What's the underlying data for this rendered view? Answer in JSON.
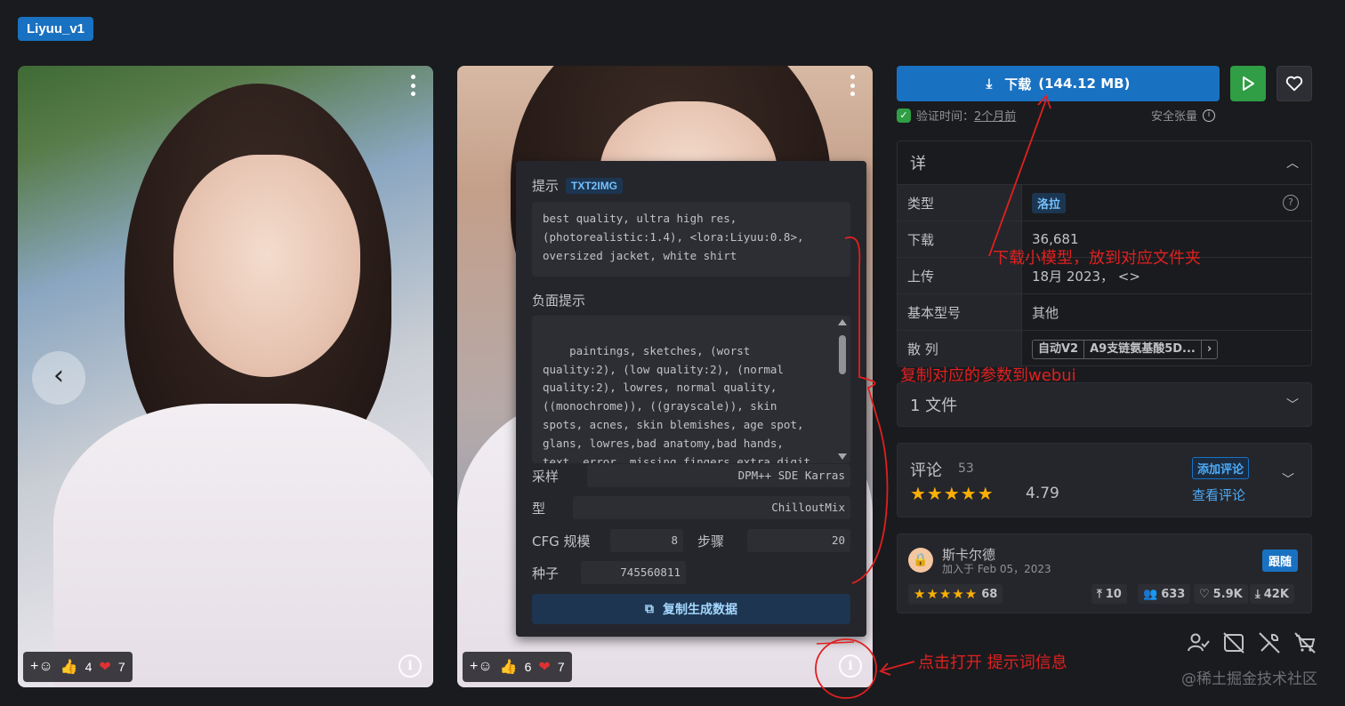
{
  "model_tag": "Liyuu_v1",
  "images": [
    {
      "reactions": {
        "add": "+",
        "like_count": "4",
        "heart_count": "7"
      }
    },
    {
      "reactions": {
        "add": "+",
        "like_count": "6",
        "heart_count": "7"
      }
    }
  ],
  "popup": {
    "prompt_label": "提示",
    "prompt_badge": "TXT2IMG",
    "prompt_text": "best quality, ultra high res, (photorealistic:1.4), <lora:Liyuu:0.8>, oversized jacket, white shirt",
    "negative_label": "负面提示",
    "negative_text": "paintings, sketches, (worst quality:2), (low quality:2), (normal quality:2), lowres, normal quality, ((monochrome)), ((grayscale)), skin spots, acnes, skin blemishes, age spot, glans, lowres,bad anatomy,bad hands, text, error, missing fingers,extra digit, fewer digits, cropped, worstquality, low quality, normal quality, jpegartifacts, signature, watermark, username, blurry",
    "sampler_label": "采样",
    "sampler_value": "DPM++ SDE Karras",
    "model_label": "型",
    "model_value": "ChilloutMix",
    "cfg_label": "CFG 规模",
    "cfg_value": "8",
    "steps_label": "步骤",
    "steps_value": "20",
    "seed_label": "种子",
    "seed_value": "745560811",
    "copy_label": "复制生成数据"
  },
  "download": {
    "label": "下载",
    "size": "(144.12 MB)"
  },
  "verified": {
    "label": "验证时间：",
    "when": "2个月前"
  },
  "safe_label": "安全张量",
  "details": {
    "title": "详",
    "rows": [
      {
        "key": "类型",
        "value": "洛拉"
      },
      {
        "key": "下载",
        "value": "36,681"
      },
      {
        "key": "上传",
        "value": "18月 2023， <>"
      },
      {
        "key": "基本型号",
        "value": "其他"
      },
      {
        "key": "散 列",
        "chips": [
          "自动V2",
          "A9支链氨基酸5D..."
        ]
      }
    ]
  },
  "files_label": "1 文件",
  "reviews": {
    "title": "评论",
    "count": "53",
    "stars": "★★★★★",
    "rating": "4.79",
    "add_label": "添加评论",
    "see_label": "查看评论"
  },
  "author": {
    "name": "斯卡尔德",
    "joined": "加入于 Feb 05，2023",
    "follow_label": "跟随",
    "rating_stars": "★★★★★",
    "rating_count": "68",
    "uploads": "10",
    "followers": "633",
    "likes": "5.9K",
    "downloads": "42K"
  },
  "watermark": "@稀土掘金技术社区",
  "annotations": {
    "download_note": "下载小模型，放到对应文件夹",
    "copy_note": "复制对应的参数到webui",
    "info_note": "点击打开 提示词信息"
  },
  "colors": {
    "accent": "#1971c2",
    "annotation": "#e02020",
    "play": "#2f9e44",
    "star": "#fab005"
  }
}
